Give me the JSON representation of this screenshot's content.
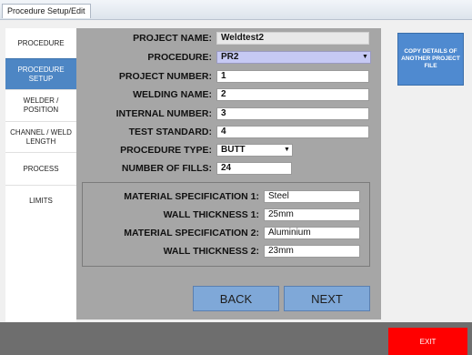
{
  "window": {
    "title": "Procedure Setup/Edit"
  },
  "sidebar": {
    "items": [
      {
        "label": "PROCEDURE"
      },
      {
        "label": "PROCEDURE SETUP"
      },
      {
        "label": "WELDER / POSITION"
      },
      {
        "label": "CHANNEL / WELD LENGTH"
      },
      {
        "label": "PROCESS"
      },
      {
        "label": "LIMITS"
      }
    ]
  },
  "form": {
    "project_name": {
      "label": "PROJECT NAME:",
      "value": "Weldtest2"
    },
    "procedure": {
      "label": "PROCEDURE:",
      "value": "PR2"
    },
    "project_number": {
      "label": "PROJECT NUMBER:",
      "value": "1"
    },
    "welding_name": {
      "label": "WELDING NAME:",
      "value": "2"
    },
    "internal_number": {
      "label": "INTERNAL NUMBER:",
      "value": "3"
    },
    "test_standard": {
      "label": "TEST STANDARD:",
      "value": "4"
    },
    "procedure_type": {
      "label": "PROCEDURE TYPE:",
      "value": "BUTT"
    },
    "number_of_fills": {
      "label": "NUMBER OF FILLS:",
      "value": "24"
    }
  },
  "materials": {
    "mat_spec_1": {
      "label": "MATERIAL SPECIFICATION 1:",
      "value": "Steel"
    },
    "wall_thickness_1": {
      "label": "WALL THICKNESS 1:",
      "value": "25mm"
    },
    "mat_spec_2": {
      "label": "MATERIAL SPECIFICATION 2:",
      "value": "Aluminium"
    },
    "wall_thickness_2": {
      "label": "WALL THICKNESS 2:",
      "value": "23mm"
    }
  },
  "buttons": {
    "back": "BACK",
    "next": "NEXT",
    "copy_details": "COPY DETAILS OF ANOTHER PROJECT FILE",
    "exit": "EXIT"
  },
  "colors": {
    "accent_blue": "#4d86c4",
    "panel_gray": "#a6a6a6",
    "selected_field": "#c6c9f4",
    "exit_red": "#ff0000"
  }
}
